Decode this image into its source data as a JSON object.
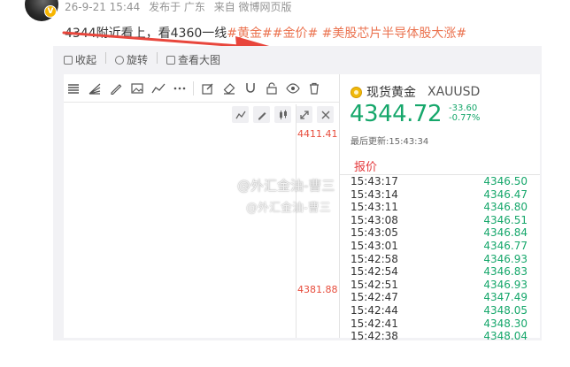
{
  "post": {
    "meta": {
      "time": "26-9-21 15:44",
      "published": "发布于 广东",
      "source": "来自 微博网页版"
    },
    "text": "4344附近看上，看4360一线",
    "tags": [
      "#黄金#",
      "#金价#",
      "#美股芯片半导体股大涨#"
    ]
  },
  "actions": {
    "collect": "收起",
    "rotate": "旋转",
    "view_large": "查看大图"
  },
  "chart": {
    "price_top": "4411.41",
    "price_mid": "4381.88"
  },
  "quote": {
    "name": "现货黄金",
    "symbol": "XAUUSD",
    "price": "4344.72",
    "change": "-33.60",
    "change_pct": "-0.77%",
    "updated": "最后更新:15:43:34",
    "tab": "报价",
    "ticks": [
      {
        "time": "15:43:17",
        "value": "4346.50"
      },
      {
        "time": "15:43:14",
        "value": "4346.47"
      },
      {
        "time": "15:43:11",
        "value": "4346.80"
      },
      {
        "time": "15:43:08",
        "value": "4346.51"
      },
      {
        "time": "15:43:05",
        "value": "4346.84"
      },
      {
        "time": "15:43:01",
        "value": "4346.77"
      },
      {
        "time": "15:42:58",
        "value": "4346.93"
      },
      {
        "time": "15:42:54",
        "value": "4346.83"
      },
      {
        "time": "15:42:51",
        "value": "4346.93"
      },
      {
        "time": "15:42:47",
        "value": "4347.49"
      },
      {
        "time": "15:42:44",
        "value": "4348.05"
      },
      {
        "time": "15:42:41",
        "value": "4348.30"
      },
      {
        "time": "15:42:38",
        "value": "4348.04"
      }
    ]
  },
  "watermark": {
    "line1": "@外汇金油-曹三",
    "line2": "@外汇金油-曹三"
  },
  "colors": {
    "accent_green": "#16a76b",
    "tag_orange": "#eb7350",
    "price_red": "#e74c3c",
    "arrow_red": "#e8463c"
  }
}
